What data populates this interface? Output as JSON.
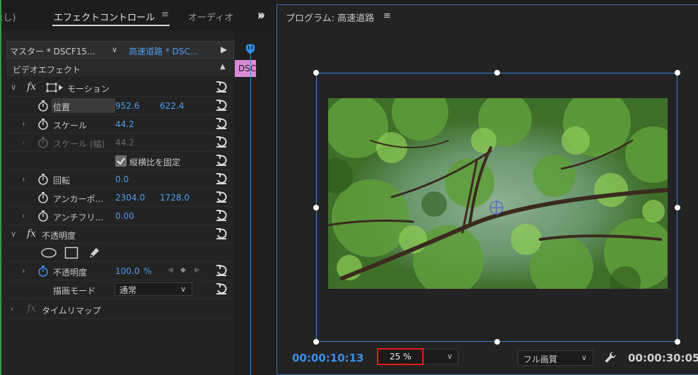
{
  "left_tabs": {
    "prev_tab_fragment": ":し)",
    "effect_controls": "エフェクトコントロール",
    "menu_glyph": "≡",
    "audio_fragment": "オーディオ",
    "overflow": "»"
  },
  "source": {
    "master": "マスター * DSCF15...",
    "chevron": "∨",
    "sequence": "高速道路 * DSC...",
    "play": "▶"
  },
  "clip_label": "DSC",
  "video_effects_header": "ビデオエフェクト",
  "effects": {
    "motion": {
      "name": "モーション",
      "position_label": "位置",
      "position_x": "952.6",
      "position_y": "622.4",
      "scale_label": "スケール",
      "scale_value": "44.2",
      "scale_width_label": "スケール (幅)",
      "scale_width_value": "44.2",
      "uniform_scale_label": "縦横比を固定",
      "rotation_label": "回転",
      "rotation_value": "0.0",
      "anchor_label": "アンカーポ...",
      "anchor_x": "2304.0",
      "anchor_y": "1728.0",
      "antiflicker_label": "アンチフリ...",
      "antiflicker_value": "0.00"
    },
    "opacity": {
      "name": "不透明度",
      "opacity_label": "不透明度",
      "opacity_value": "100.0",
      "opacity_unit": "%",
      "blend_mode_label": "描画モード",
      "blend_mode_value": "通常"
    },
    "time_remap": {
      "name": "タイムリマップ"
    }
  },
  "program": {
    "title": "プログラム: 高速道路",
    "menu_glyph": "≡",
    "current_timecode": "00:00:10:13",
    "zoom": "25 %",
    "quality": "フル画質",
    "duration_timecode": "00:00:30:05"
  },
  "colors": {
    "accent_blue": "#4c9df2",
    "clip_pink": "#d98ad6",
    "highlight_red": "#e31b1b",
    "panel_bg": "#232323"
  }
}
